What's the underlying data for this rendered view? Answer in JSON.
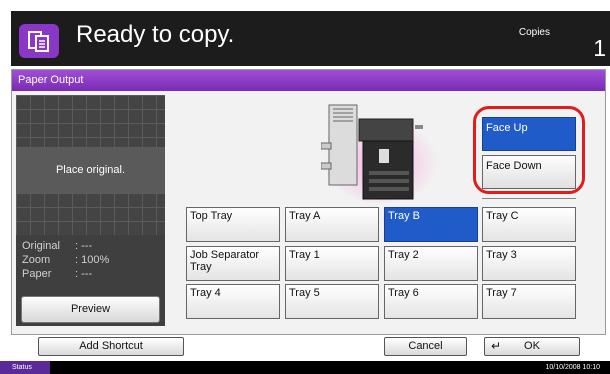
{
  "header": {
    "status_message": "Ready to copy.",
    "copies_label": "Copies",
    "copies_count": "1",
    "icon": "copy-icon"
  },
  "panel": {
    "title": "Paper Output"
  },
  "preview": {
    "placeholder": "Place original.",
    "info": [
      {
        "key": "Original",
        "value": ": ---"
      },
      {
        "key": "Zoom",
        "value": ": 100%"
      },
      {
        "key": "Paper",
        "value": ": ---"
      }
    ],
    "button_label": "Preview"
  },
  "face": {
    "options": [
      "Face Up",
      "Face Down"
    ],
    "selected": "Face Up"
  },
  "trays": {
    "rows": [
      [
        "Top Tray",
        "Tray A",
        "Tray B",
        "Tray C"
      ],
      [
        "Job Separator Tray",
        "Tray 1",
        "Tray 2",
        "Tray 3"
      ],
      [
        "Tray 4",
        "Tray 5",
        "Tray 6",
        "Tray 7"
      ]
    ],
    "selected": "Tray B"
  },
  "footer": {
    "add_shortcut": "Add Shortcut",
    "cancel": "Cancel",
    "ok": "OK"
  },
  "status_bar": {
    "status": "Status",
    "datetime": "10/10/2008   10:10"
  },
  "colors": {
    "accent": "#8a37c8",
    "selected": "#1f5cc9",
    "highlight": "#e11c1c"
  }
}
